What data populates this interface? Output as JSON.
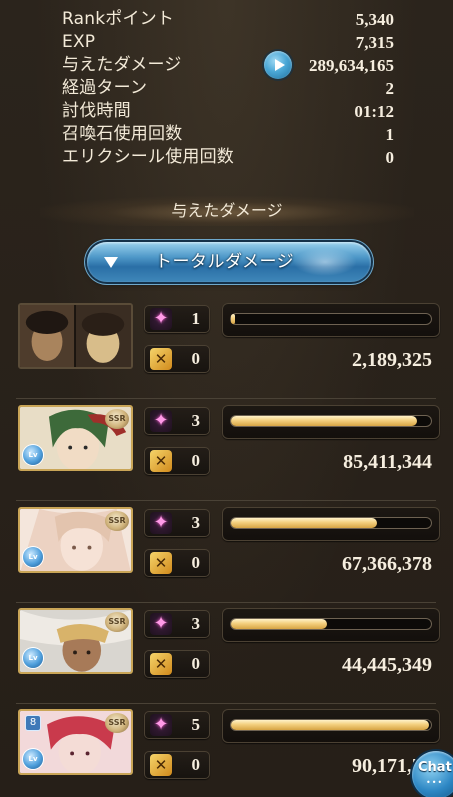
{
  "stats": [
    {
      "label": "Rankポイント",
      "value": "5,340"
    },
    {
      "label": "EXP",
      "value": "7,315"
    },
    {
      "label": "与えたダメージ",
      "value": "289,634,165"
    },
    {
      "label": "経過ターン",
      "value": "2"
    },
    {
      "label": "討伐時間",
      "value": "01:12"
    },
    {
      "label": "召喚石使用回数",
      "value": "1"
    },
    {
      "label": "エリクシール使用回数",
      "value": "0"
    }
  ],
  "section_title": "与えたダメージ",
  "dropdown": {
    "label": "トータルダメージ"
  },
  "characters": [
    {
      "ougi_count": "1",
      "chain_count": "0",
      "damage": "2,189,325",
      "damage_fraction": 0.02,
      "badge": "",
      "portrait_colors": [
        "#6e5a46",
        "#2e2218",
        "#b08f64"
      ]
    },
    {
      "ougi_count": "3",
      "chain_count": "0",
      "damage": "85,411,344",
      "damage_fraction": 0.93,
      "badge": "SSR",
      "portrait_colors": [
        "#e9dfc8",
        "#3f6b3a",
        "#c6b28c"
      ]
    },
    {
      "ougi_count": "3",
      "chain_count": "0",
      "damage": "67,366,378",
      "damage_fraction": 0.73,
      "badge": "SSR",
      "portrait_colors": [
        "#f3ddd3",
        "#d9b6a2",
        "#efe3d9"
      ]
    },
    {
      "ougi_count": "3",
      "chain_count": "0",
      "damage": "44,445,349",
      "damage_fraction": 0.48,
      "badge": "SSR",
      "portrait_colors": [
        "#dcd8d2",
        "#8c6a4c",
        "#c2b7aa"
      ]
    },
    {
      "ougi_count": "5",
      "chain_count": "0",
      "damage": "90,171,70",
      "damage_fraction": 0.99,
      "badge": "SSR",
      "portrait_colors": [
        "#f0c2c6",
        "#c33a4a",
        "#f4dfe0"
      ]
    }
  ],
  "chat": {
    "label": "Chat",
    "dots": "•••"
  },
  "icons": {
    "play": "play-icon",
    "ougi": "sparkle-icon",
    "chain": "chain-burst-icon"
  },
  "colors": {
    "accent_blue": "#4a9ad0",
    "bar_gold": "#f3cf7e"
  }
}
